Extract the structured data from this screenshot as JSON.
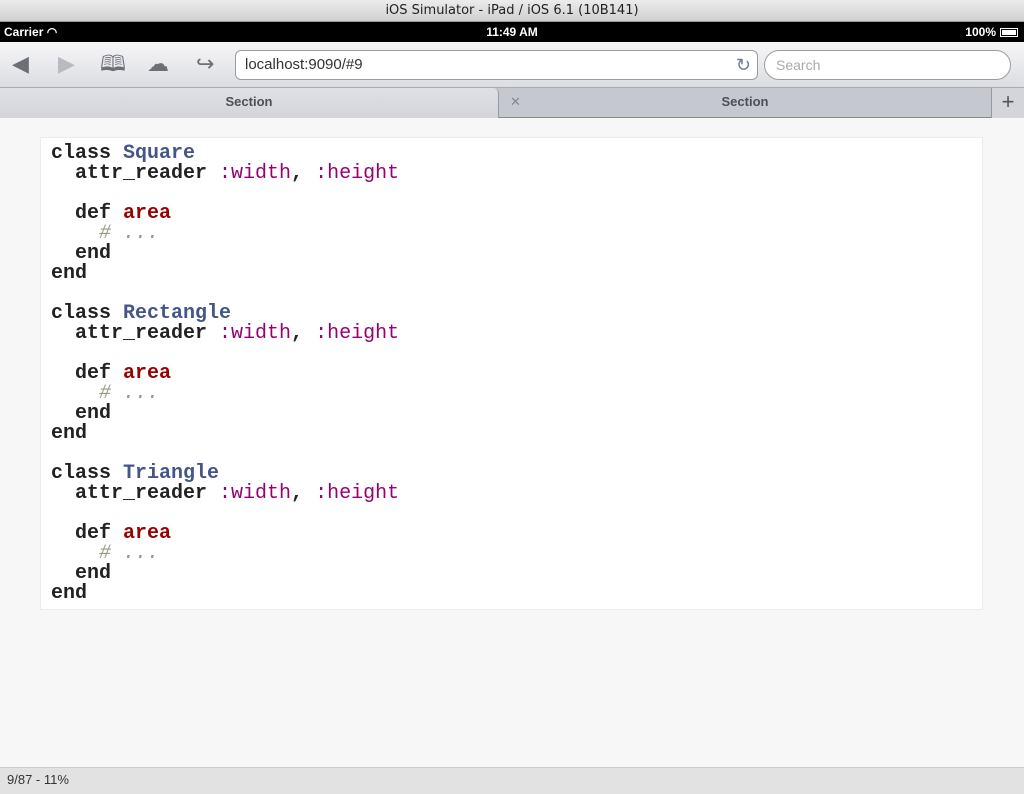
{
  "window": {
    "title": "iOS Simulator - iPad / iOS 6.1 (10B141)"
  },
  "status_bar": {
    "carrier": "Carrier",
    "time": "11:49 AM",
    "battery": "100%",
    "battery_level": 1.0
  },
  "toolbar": {
    "url": "localhost:9090/#9",
    "search_placeholder": "Search",
    "icons": [
      "back-arrow",
      "forward-arrow",
      "bookmarks-book",
      "icloud-tabs",
      "share"
    ]
  },
  "tabs": [
    {
      "label": "Section",
      "active": true
    },
    {
      "label": "Section",
      "active": false
    }
  ],
  "code": {
    "lines": [
      [
        [
          "k",
          "class "
        ],
        [
          "cls",
          "Square"
        ]
      ],
      [
        [
          "k",
          "  attr_reader "
        ],
        [
          "sym",
          ":width"
        ],
        [
          "k",
          ", "
        ],
        [
          "sym",
          ":height"
        ]
      ],
      [],
      [
        [
          "k",
          "  def "
        ],
        [
          "fn",
          "area"
        ]
      ],
      [
        [
          "cm",
          "    # ..."
        ]
      ],
      [
        [
          "k",
          "  end"
        ]
      ],
      [
        [
          "k",
          "end"
        ]
      ],
      [],
      [
        [
          "k",
          "class "
        ],
        [
          "cls",
          "Rectangle"
        ]
      ],
      [
        [
          "k",
          "  attr_reader "
        ],
        [
          "sym",
          ":width"
        ],
        [
          "k",
          ", "
        ],
        [
          "sym",
          ":height"
        ]
      ],
      [],
      [
        [
          "k",
          "  def "
        ],
        [
          "fn",
          "area"
        ]
      ],
      [
        [
          "cm",
          "    # ..."
        ]
      ],
      [
        [
          "k",
          "  end"
        ]
      ],
      [
        [
          "k",
          "end"
        ]
      ],
      [],
      [
        [
          "k",
          "class "
        ],
        [
          "cls",
          "Triangle"
        ]
      ],
      [
        [
          "k",
          "  attr_reader "
        ],
        [
          "sym",
          ":width"
        ],
        [
          "k",
          ", "
        ],
        [
          "sym",
          ":height"
        ]
      ],
      [],
      [
        [
          "k",
          "  def "
        ],
        [
          "fn",
          "area"
        ]
      ],
      [
        [
          "cm",
          "    # ..."
        ]
      ],
      [
        [
          "k",
          "  end"
        ]
      ],
      [
        [
          "k",
          "end"
        ]
      ]
    ]
  },
  "footer": {
    "progress": "9/87 - 11%"
  }
}
